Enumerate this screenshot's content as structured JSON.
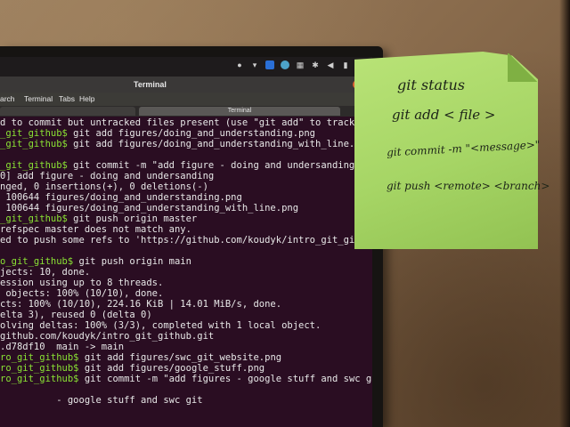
{
  "window": {
    "title": "Terminal"
  },
  "menubar": {
    "items": [
      "arch",
      "Terminal",
      "Tabs",
      "Help"
    ]
  },
  "tabs": [
    {
      "label": ""
    },
    {
      "label": "Terminal"
    }
  ],
  "tray": {
    "icons": [
      "accessibility-icon",
      "chevron-down-icon",
      "app-indicator-icon",
      "steam-icon",
      "network-icon",
      "bluetooth-icon",
      "volume-icon",
      "battery-icon",
      "chevron-down-icon"
    ]
  },
  "terminal": {
    "lines": [
      {
        "prompt": "",
        "text": "d to commit but untracked files present (use \"git add\" to track)"
      },
      {
        "prompt": "_git_github$",
        "text": " git add figures/doing_and_understanding.png"
      },
      {
        "prompt": "_git_github$",
        "text": " git add figures/doing_and_understanding_with_line.p"
      },
      {
        "prompt": "",
        "text": ""
      },
      {
        "prompt": "_git_github$",
        "text": " git commit -m \"add figure - doing and undersanding\""
      },
      {
        "prompt": "",
        "text": "0] add figure - doing and undersanding"
      },
      {
        "prompt": "",
        "text": "nged, 0 insertions(+), 0 deletions(-)"
      },
      {
        "prompt": "",
        "text": " 100644 figures/doing_and_understanding.png"
      },
      {
        "prompt": "",
        "text": " 100644 figures/doing_and_understanding_with_line.png"
      },
      {
        "prompt": "_git_github$",
        "text": " git push origin master"
      },
      {
        "prompt": "",
        "text": "refspec master does not match any."
      },
      {
        "prompt": "",
        "text": "ed to push some refs to 'https://github.com/koudyk/intro_git_gith"
      },
      {
        "prompt": "",
        "text": ""
      },
      {
        "prompt": "o_git_github$",
        "text": " git push origin main"
      },
      {
        "prompt": "",
        "text": "jects: 10, done."
      },
      {
        "prompt": "",
        "text": "ession using up to 8 threads."
      },
      {
        "prompt": "",
        "text": " objects: 100% (10/10), done."
      },
      {
        "prompt": "",
        "text": "cts: 100% (10/10), 224.16 KiB | 14.01 MiB/s, done."
      },
      {
        "prompt": "",
        "text": "elta 3), reused 0 (delta 0)"
      },
      {
        "prompt": "",
        "text": "olving deltas: 100% (3/3), completed with 1 local object."
      },
      {
        "prompt": "",
        "text": "github.com/koudyk/intro_git_github.git"
      },
      {
        "prompt": "",
        "text": ".d78df10  main -> main"
      },
      {
        "prompt": "ro_git_github$",
        "text": " git add figures/swc_git_website.png"
      },
      {
        "prompt": "ro_git_github$",
        "text": " git add figures/google_stuff.png"
      },
      {
        "prompt": "ro_git_github$",
        "text": " git commit -m \"add figures - google stuff and swc g"
      },
      {
        "prompt": "",
        "text": ""
      },
      {
        "prompt": "",
        "text": "          - google stuff and swc git"
      }
    ]
  },
  "sticky_note": {
    "lines": [
      "git status",
      "git add < file >",
      "git commit -m \"<message>\"",
      "git push <remote> <branch>"
    ]
  }
}
